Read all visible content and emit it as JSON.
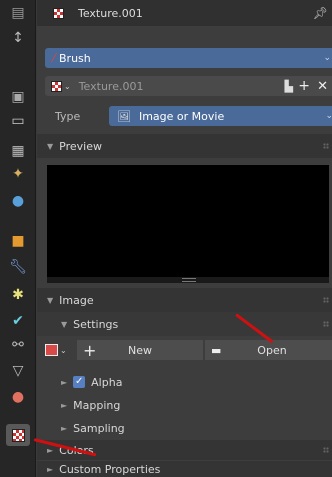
{
  "texture_header": {
    "name": "Texture.001",
    "pin_icon": "pin-icon"
  },
  "brush_selector": {
    "label": "Brush",
    "icon": "brush-icon"
  },
  "texture_datablock": {
    "name": "Texture.001",
    "icons": [
      "browse-texture-icon",
      "fake-user-icon",
      "add-icon",
      "close-icon"
    ]
  },
  "type_row": {
    "label": "Type",
    "value": "Image or Movie",
    "icon": "image-icon"
  },
  "preview_panel": {
    "title": "Preview"
  },
  "image_panel": {
    "title": "Image",
    "settings": {
      "title": "Settings",
      "new_label": "New",
      "open_label": "Open"
    },
    "subpanels": [
      "Alpha",
      "Mapping",
      "Sampling"
    ],
    "alpha_checked": true
  },
  "colors_panel": {
    "title": "Colors"
  },
  "custom_properties_panel": {
    "title": "Custom Properties"
  },
  "tab_strip": {
    "tabs": [
      "tool-icon",
      "render-icon",
      "output-icon",
      "view-layer-icon",
      "scene-icon",
      "world-icon",
      "object-icon",
      "modifier-icon",
      "particles-icon",
      "physics-icon",
      "constraints-icon",
      "data-icon",
      "material-icon",
      "texture-icon"
    ],
    "active": "texture-icon"
  },
  "colors": {
    "accent_blue": "#4a6a9a",
    "annotation_red": "#d01010"
  }
}
